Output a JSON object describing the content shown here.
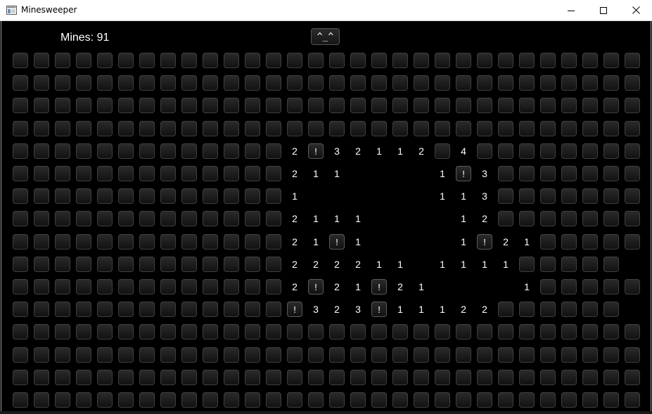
{
  "window": {
    "title": "Minesweeper",
    "controls": [
      "minimize",
      "maximize",
      "close"
    ]
  },
  "status": {
    "mine_counter": "Mines: 91",
    "face_label": "^_^"
  },
  "colors": {
    "background": "#000000",
    "cell_fill": "#1c1c1c",
    "cell_border": "#3f3f3f",
    "text": "#ffffff"
  },
  "board": {
    "cols": 30,
    "rows": 16,
    "legend": {
      "#": "hidden",
      "F": "flagged (!)",
      ".": "revealed empty",
      "1-8": "revealed number"
    },
    "flag_glyph": "!",
    "grid": [
      "##############################",
      "##############################",
      "##############################",
      "##############################",
      "#############2F32112#4########",
      "#############211....1F3#######",
      "#############1......113#######",
      "#############2111....12#######",
      "#############21F1....1F21#####",
      "#############222211.1111#####",
      "#############2F21F21....1#####",
      "#############F323F11122######",
      "##############################",
      "##############################",
      "##############################",
      "##############################"
    ]
  }
}
